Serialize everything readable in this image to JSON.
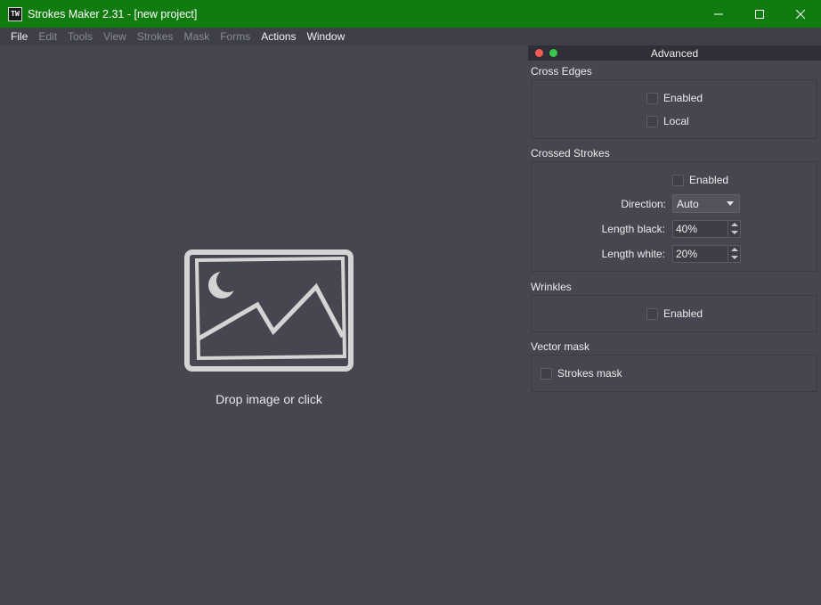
{
  "window": {
    "title": "Strokes Maker 2.31 - [new project]",
    "app_icon_text": "TW",
    "accent": "#107c10"
  },
  "menu": {
    "items": [
      {
        "label": "File",
        "enabled": true
      },
      {
        "label": "Edit",
        "enabled": false
      },
      {
        "label": "Tools",
        "enabled": false
      },
      {
        "label": "View",
        "enabled": false
      },
      {
        "label": "Strokes",
        "enabled": false
      },
      {
        "label": "Mask",
        "enabled": false
      },
      {
        "label": "Forms",
        "enabled": false
      },
      {
        "label": "Actions",
        "enabled": true
      },
      {
        "label": "Window",
        "enabled": true
      }
    ]
  },
  "canvas": {
    "drop_text": "Drop image or click",
    "icon": "image-placeholder-icon"
  },
  "panel": {
    "title": "Advanced",
    "cross_edges": {
      "title": "Cross Edges",
      "enabled_label": "Enabled",
      "enabled": false,
      "local_label": "Local",
      "local": false
    },
    "crossed_strokes": {
      "title": "Crossed Strokes",
      "enabled_label": "Enabled",
      "enabled": false,
      "direction_label": "Direction:",
      "direction_value": "Auto",
      "length_black_label": "Length black:",
      "length_black_value": "40%",
      "length_white_label": "Length white:",
      "length_white_value": "20%"
    },
    "wrinkles": {
      "title": "Wrinkles",
      "enabled_label": "Enabled",
      "enabled": false
    },
    "vector_mask": {
      "title": "Vector mask",
      "strokes_mask_label": "Strokes mask",
      "strokes_mask": false
    }
  }
}
